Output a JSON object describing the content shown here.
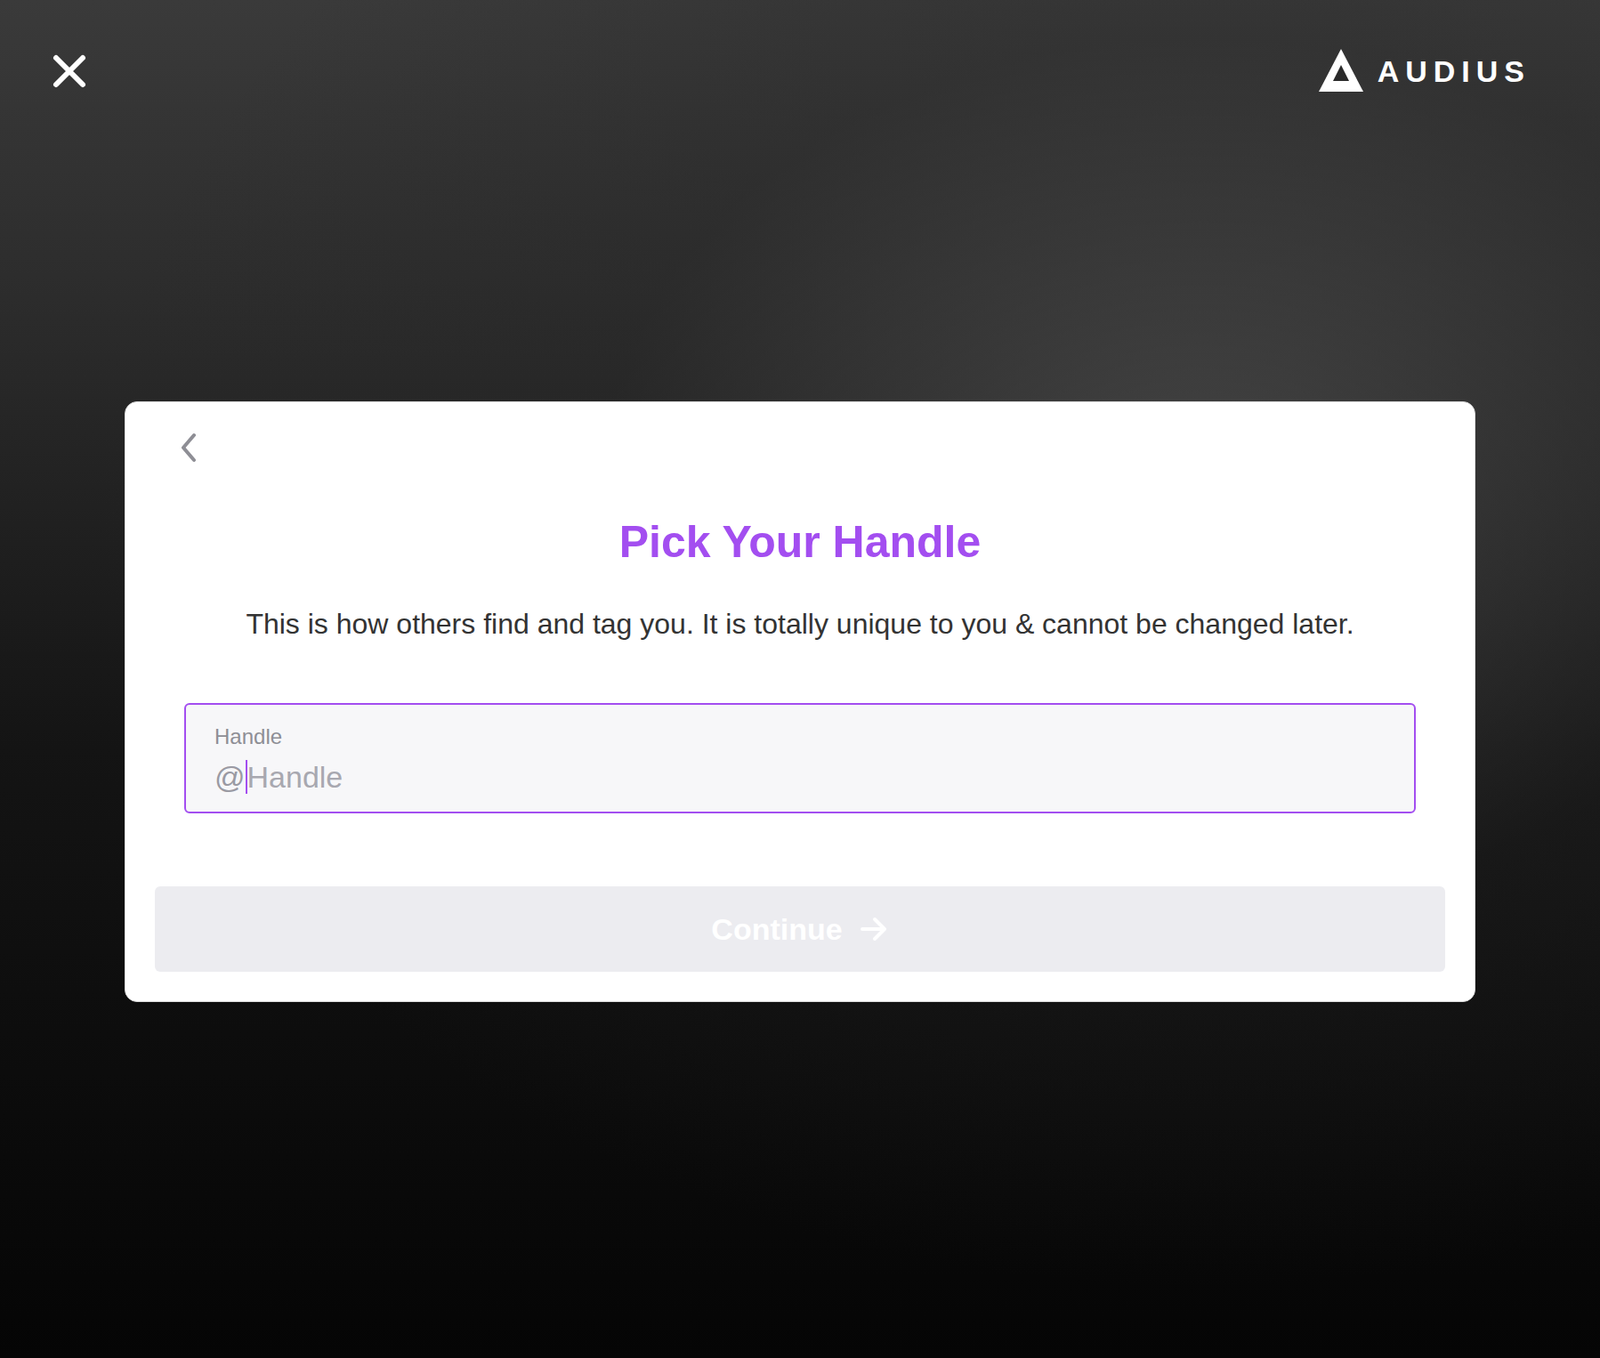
{
  "logo": {
    "text": "AUDIUS"
  },
  "dialog": {
    "title": "Pick Your Handle",
    "description": "This is how others find and tag you. It is totally unique to you & cannot be changed later.",
    "field": {
      "label": "Handle",
      "prefix": "@",
      "placeholder": "Handle",
      "focused": true
    },
    "continue_button": {
      "label": "Continue",
      "disabled": true
    }
  }
}
